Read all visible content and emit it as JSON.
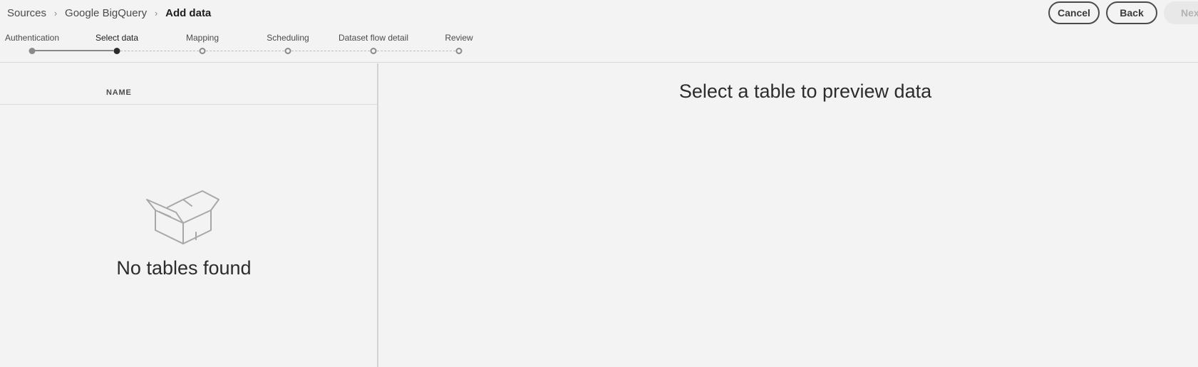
{
  "breadcrumb": {
    "items": [
      "Sources",
      "Google BigQuery",
      "Add data"
    ],
    "separator": "›"
  },
  "actions": {
    "cancel_label": "Cancel",
    "back_label": "Back",
    "next_label": "Next"
  },
  "stepper": {
    "steps": [
      "Authentication",
      "Select data",
      "Mapping",
      "Scheduling",
      "Dataset flow detail",
      "Review"
    ],
    "current_index": 1
  },
  "table_list": {
    "column_header": "NAME",
    "empty_icon": "open-box-icon",
    "empty_message": "No tables found"
  },
  "preview": {
    "message": "Select a table to preview data"
  }
}
